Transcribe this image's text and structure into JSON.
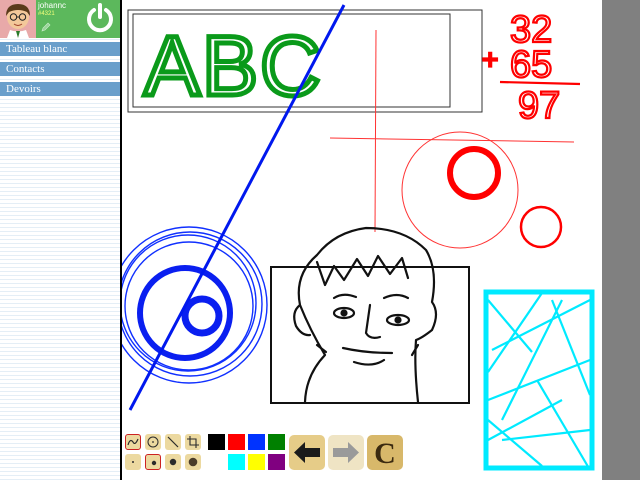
{
  "user": {
    "name": "johannc",
    "code": "#4321"
  },
  "menu": {
    "items": [
      "Tableau blanc",
      "Contacts",
      "Devoirs"
    ]
  },
  "toolbox": {
    "colors": {
      "black": "#000000",
      "red": "#ff0000",
      "blue": "#0033ff",
      "green": "#008000",
      "cyan": "#00ffff",
      "yellow": "#ffff00",
      "purple": "#800080"
    },
    "clear_label": "C"
  },
  "drawing": {
    "letters": "ABC",
    "sum_line1": "32",
    "sum_line2": "65",
    "plus": "+",
    "result": "97"
  }
}
